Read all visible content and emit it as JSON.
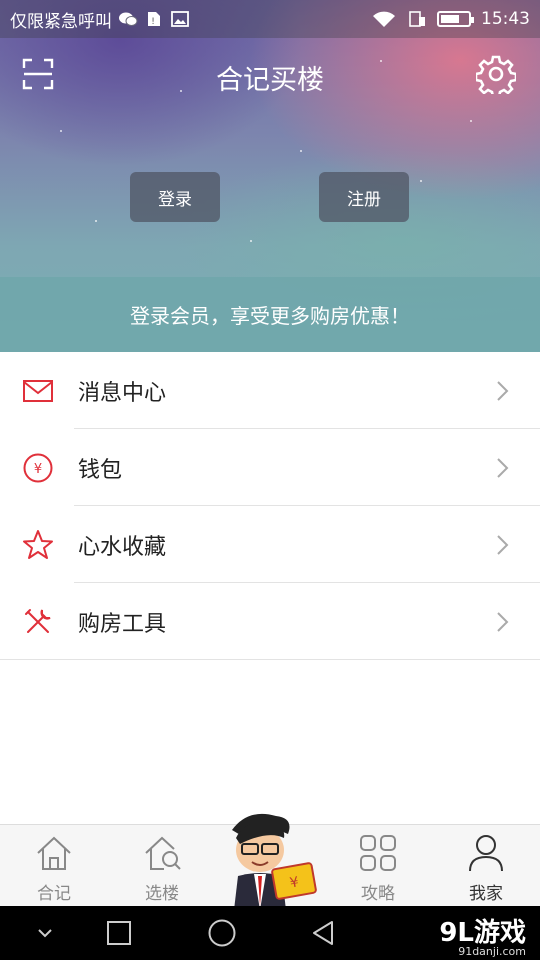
{
  "status_bar": {
    "carrier_text": "仅限紧急呼叫",
    "time": "15:43",
    "battery_level": 0.7,
    "icons": [
      "wechat-icon",
      "sim-alert-icon",
      "image-icon",
      "wifi-icon",
      "sim-icon",
      "battery-icon"
    ]
  },
  "header": {
    "title": "合记买楼",
    "left_icon": "scan-icon",
    "right_icon": "gear-icon"
  },
  "auth": {
    "login_label": "登录",
    "register_label": "注册"
  },
  "promo": {
    "text": "登录会员，享受更多购房优惠！"
  },
  "menu": {
    "items": [
      {
        "label": "消息中心",
        "icon": "envelope-icon"
      },
      {
        "label": "钱包",
        "icon": "yen-coin-icon"
      },
      {
        "label": "心水收藏",
        "icon": "star-icon"
      },
      {
        "label": "购房工具",
        "icon": "tools-icon"
      }
    ]
  },
  "tabs": [
    {
      "label": "合记",
      "icon": "home-icon",
      "active": false
    },
    {
      "label": "选楼",
      "icon": "house-search-icon",
      "active": false
    },
    {
      "label": "攻略",
      "icon": "grid-icon",
      "active": false
    },
    {
      "label": "我家",
      "icon": "person-icon",
      "active": true
    }
  ],
  "mascot": {
    "icon": "mascot-icon"
  },
  "watermark": {
    "main": "9L游戏",
    "sub": "91danji.com"
  },
  "colors": {
    "accent": "#e0303a",
    "tab_inactive": "#888888",
    "tab_active": "#333333"
  }
}
